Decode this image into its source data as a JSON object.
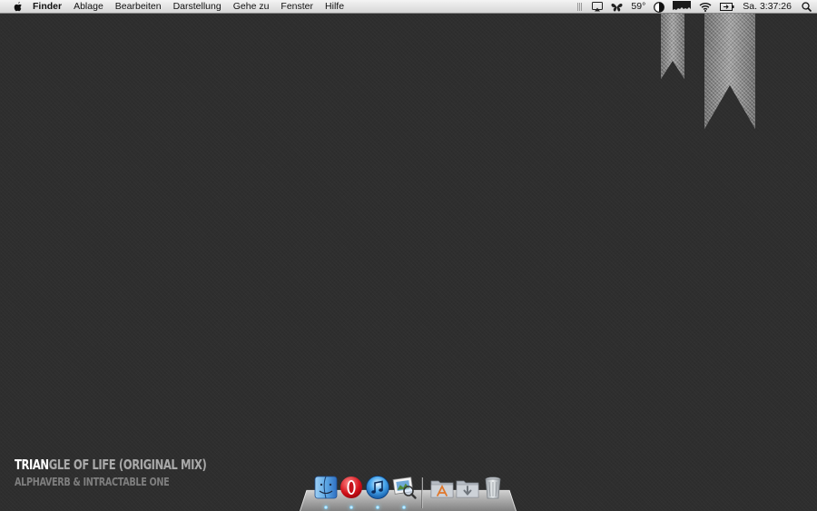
{
  "menubar": {
    "apple_icon": "apple-logo-icon",
    "app_name": "Finder",
    "menus": [
      "Ablage",
      "Bearbeiten",
      "Darstellung",
      "Gehe zu",
      "Fenster",
      "Hilfe"
    ],
    "status": {
      "temperature": "59°",
      "clock": "Sa. 3:37:26",
      "icons": [
        "menu-grip-icon",
        "airplay-display-icon",
        "butterfly-icon",
        "weather-icon",
        "contrast-icon",
        "activity-graph-icon",
        "wifi-icon",
        "battery-icon",
        "spotlight-icon"
      ]
    }
  },
  "now_playing": {
    "title_highlight": "TRIAN",
    "title_rest": "GLE OF LIFE (ORIGINAL MIX)",
    "artist": "ALPHAVERB & INTRACTABLE ONE"
  },
  "dock": {
    "apps": [
      {
        "name": "Finder",
        "icon": "finder-icon",
        "running": true
      },
      {
        "name": "Opera",
        "icon": "opera-icon",
        "running": true
      },
      {
        "name": "iTunes",
        "icon": "itunes-icon",
        "running": true
      },
      {
        "name": "Preview",
        "icon": "preview-icon",
        "running": true
      }
    ],
    "stacks": [
      {
        "name": "Applications",
        "icon": "applications-folder-icon"
      },
      {
        "name": "Downloads",
        "icon": "downloads-folder-icon"
      },
      {
        "name": "Trash",
        "icon": "trash-icon"
      }
    ]
  },
  "colors": {
    "desktop": "#2e2e2e",
    "ribbon": "#8c8c8c",
    "title_highlight": "#ffffff",
    "title": "#a9a9a9",
    "artist": "#7e7e7e"
  }
}
